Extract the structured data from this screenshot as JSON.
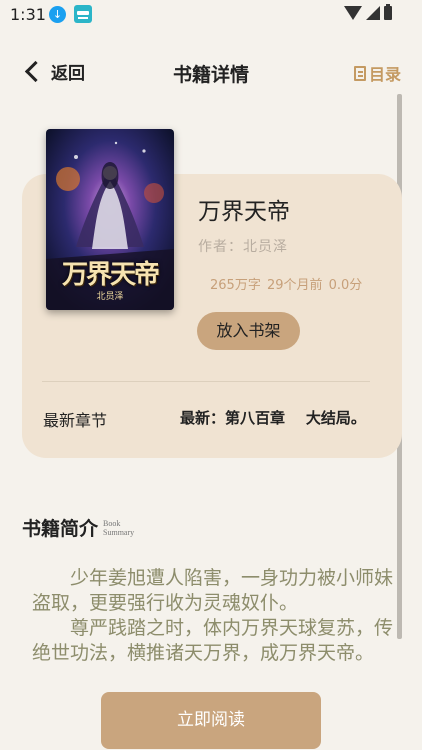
{
  "status_bar": {
    "time": "1:31"
  },
  "navbar": {
    "back_label": "返回",
    "title": "书籍详情",
    "toc_label": "目录"
  },
  "book": {
    "title": "万界天帝",
    "author": "作者：北员泽",
    "stats": "265万字  29个月前  0.0分",
    "shelf_button": "放入书架",
    "latest_label": "最新章节",
    "latest_value": "最新：第八百章    大结局。",
    "cover_title": "万界天帝",
    "cover_author": "北员泽"
  },
  "intro": {
    "title": "书籍简介",
    "subtitle_line1": "Book",
    "subtitle_line2": "Summary",
    "paragraphs": [
      "少年姜旭遭人陷害，一身功力被小师妹盗取，更要强行收为灵魂奴仆。",
      "尊严践踏之时，体内万界天球复苏，传绝世功法，横推诸天万界，成万界天帝。"
    ]
  },
  "read_button": "立即阅读",
  "colors": {
    "accent": "#c9a57e",
    "card": "#f0e3d2",
    "background": "#f5f2ec"
  }
}
